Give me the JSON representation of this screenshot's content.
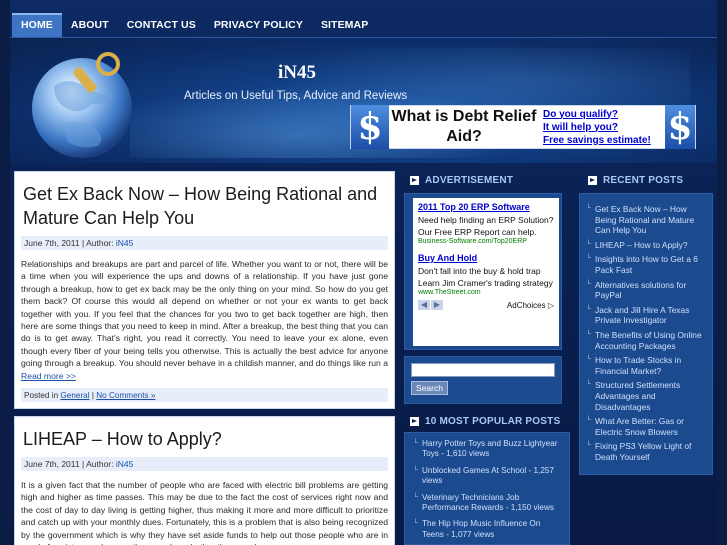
{
  "nav": {
    "items": [
      "Home",
      "About",
      "Contact Us",
      "Privacy Policy",
      "Sitemap"
    ]
  },
  "header": {
    "title": "iN45",
    "description": "Articles on Useful Tips, Advice and Reviews"
  },
  "banner_ad": {
    "headline": "What is Debt Relief Aid?",
    "links": [
      "Do you qualify?",
      "It will help you?",
      "Free savings estimate!"
    ]
  },
  "posts": [
    {
      "title": "Get Ex Back Now – How Being Rational and Mature Can Help You",
      "date": "June 7th, 2011",
      "author_label": "Author:",
      "author": "iN45",
      "excerpt": "Relationships and breakups are part and parcel of life. Whether you want to or not, there will be a time when you will experience the ups and downs of a relationship. If you have just gone through a breakup, how to get ex back may be the only thing on your mind. So how do you get them back? Of course this would all depend on whether or not your ex wants to get back together with you. If you feel that the chances for you two to get back together are high, then here are some things that you need to keep in mind. After a breakup, the best thing that you can do is to get away. That's right, you read it correctly. You need to leave your ex alone, even though every fiber of your being tells you otherwise. This is actually the best advice for anyone going through a breakup. You should never behave in a childish manner, and do things like run a",
      "read_more": "Read more >>",
      "posted_in": "Posted in",
      "category": "General",
      "comments": "No Comments »"
    },
    {
      "title": "LIHEAP – How to Apply?",
      "date": "June 7th, 2011",
      "author_label": "Author:",
      "author": "iN45",
      "excerpt": "It is a given fact that the number of people who are faced with electric bill problems are getting high and higher as time passes. This may be due to the fact the cost of services right now and the cost of day to day living is getting higher, thus making it more and more difficult to prioritize and catch up with your monthly dues. Fortunately, this is a problem that is also being recognized by the government which is why they have set aside funds to help out those people who are in need of assistance wherever they may be; whether they may be"
    }
  ],
  "sidebar": {
    "ad_heading": "Advertisement",
    "ads": [
      {
        "title": "2011 Top 20 ERP Software",
        "text": "Need help finding an ERP Solution? Our Free ERP Report can help.",
        "url": "Business-Software.com/Top20ERP"
      },
      {
        "title": "Buy And Hold",
        "text": "Don't fall into the buy & hold trap Learn Jim Cramer's trading strategy",
        "url": "www.TheStreet.com"
      }
    ],
    "adchoices": "AdChoices",
    "search_button": "Search",
    "popular_heading": "10 Most Popular Posts",
    "popular": [
      "Harry Potter Toys and Buzz Lightyear Toys - 1,610 views",
      "Unblocked Games At School - 1,257 views",
      "Veterinary Technicians Job Performance Rewards - 1,150 views",
      "The Hip Hop Music Influence On Teens - 1,077 views"
    ],
    "recent_heading": "Recent Posts",
    "recent": [
      "Get Ex Back Now – How Being Rational and Mature Can Help You",
      "LIHEAP – How to Apply?",
      "Insights into How to Get a 6 Pack Fast",
      "Alternatives solutions for PayPal",
      "Jack and Jill Hire A Texas Private Investigator",
      "The Benefits of Using Online Accounting Packages",
      "How to Trade Stocks in Financial Market?",
      "Structured Settlements Advantages and Disadvantages",
      "What Are Better: Gas or Electric Snow Blowers",
      "Fixing PS3 Yellow Light of Death Yourself"
    ]
  },
  "colors": {
    "page_bg": "#0a1e4a",
    "nav_active": "#3e74c4",
    "widget_bg": "#1c4a8f",
    "link": "#1a4fa8",
    "sidebar_heading": "#a9c8f5"
  }
}
